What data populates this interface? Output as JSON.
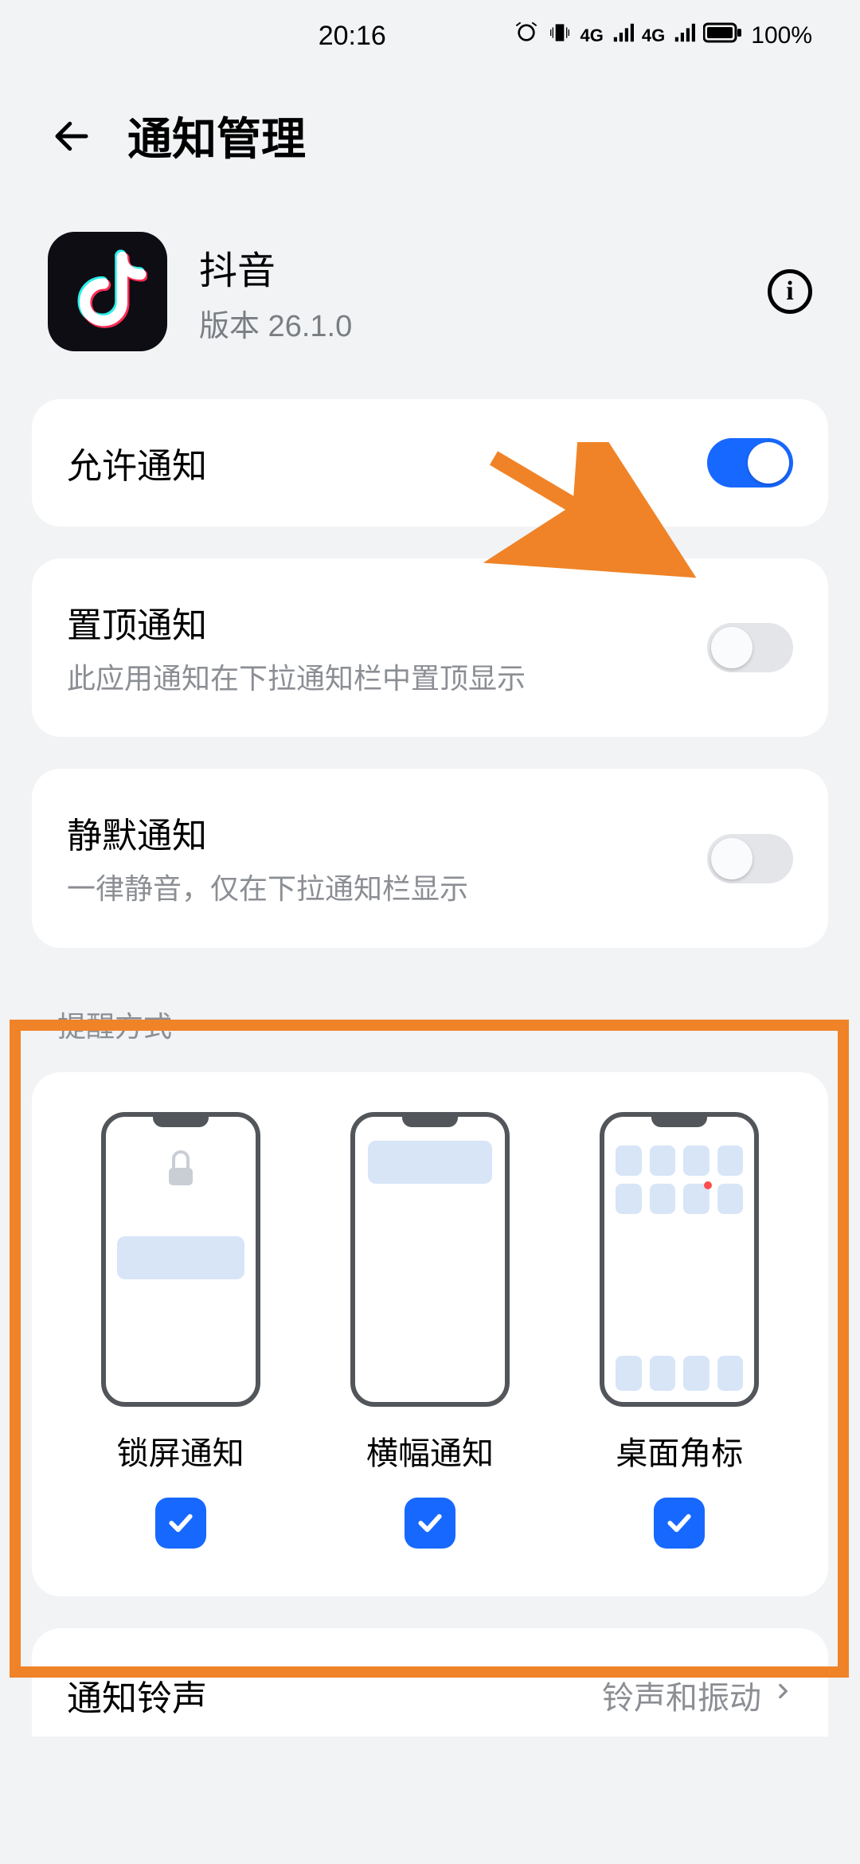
{
  "status": {
    "time": "20:16",
    "battery_pct": "100%"
  },
  "header": {
    "title": "通知管理"
  },
  "app": {
    "name": "抖音",
    "version_label": "版本 26.1.0"
  },
  "toggles": {
    "allow": {
      "label": "允许通知",
      "on": true
    },
    "pin": {
      "label": "置顶通知",
      "sub": "此应用通知在下拉通知栏中置顶显示",
      "on": false
    },
    "silent": {
      "label": "静默通知",
      "sub": "一律静音，仅在下拉通知栏显示",
      "on": false
    }
  },
  "reminder": {
    "header": "提醒方式",
    "styles": [
      {
        "label": "锁屏通知",
        "checked": true
      },
      {
        "label": "横幅通知",
        "checked": true
      },
      {
        "label": "桌面角标",
        "checked": true
      }
    ]
  },
  "ringtone": {
    "label": "通知铃声",
    "value": "铃声和振动"
  }
}
